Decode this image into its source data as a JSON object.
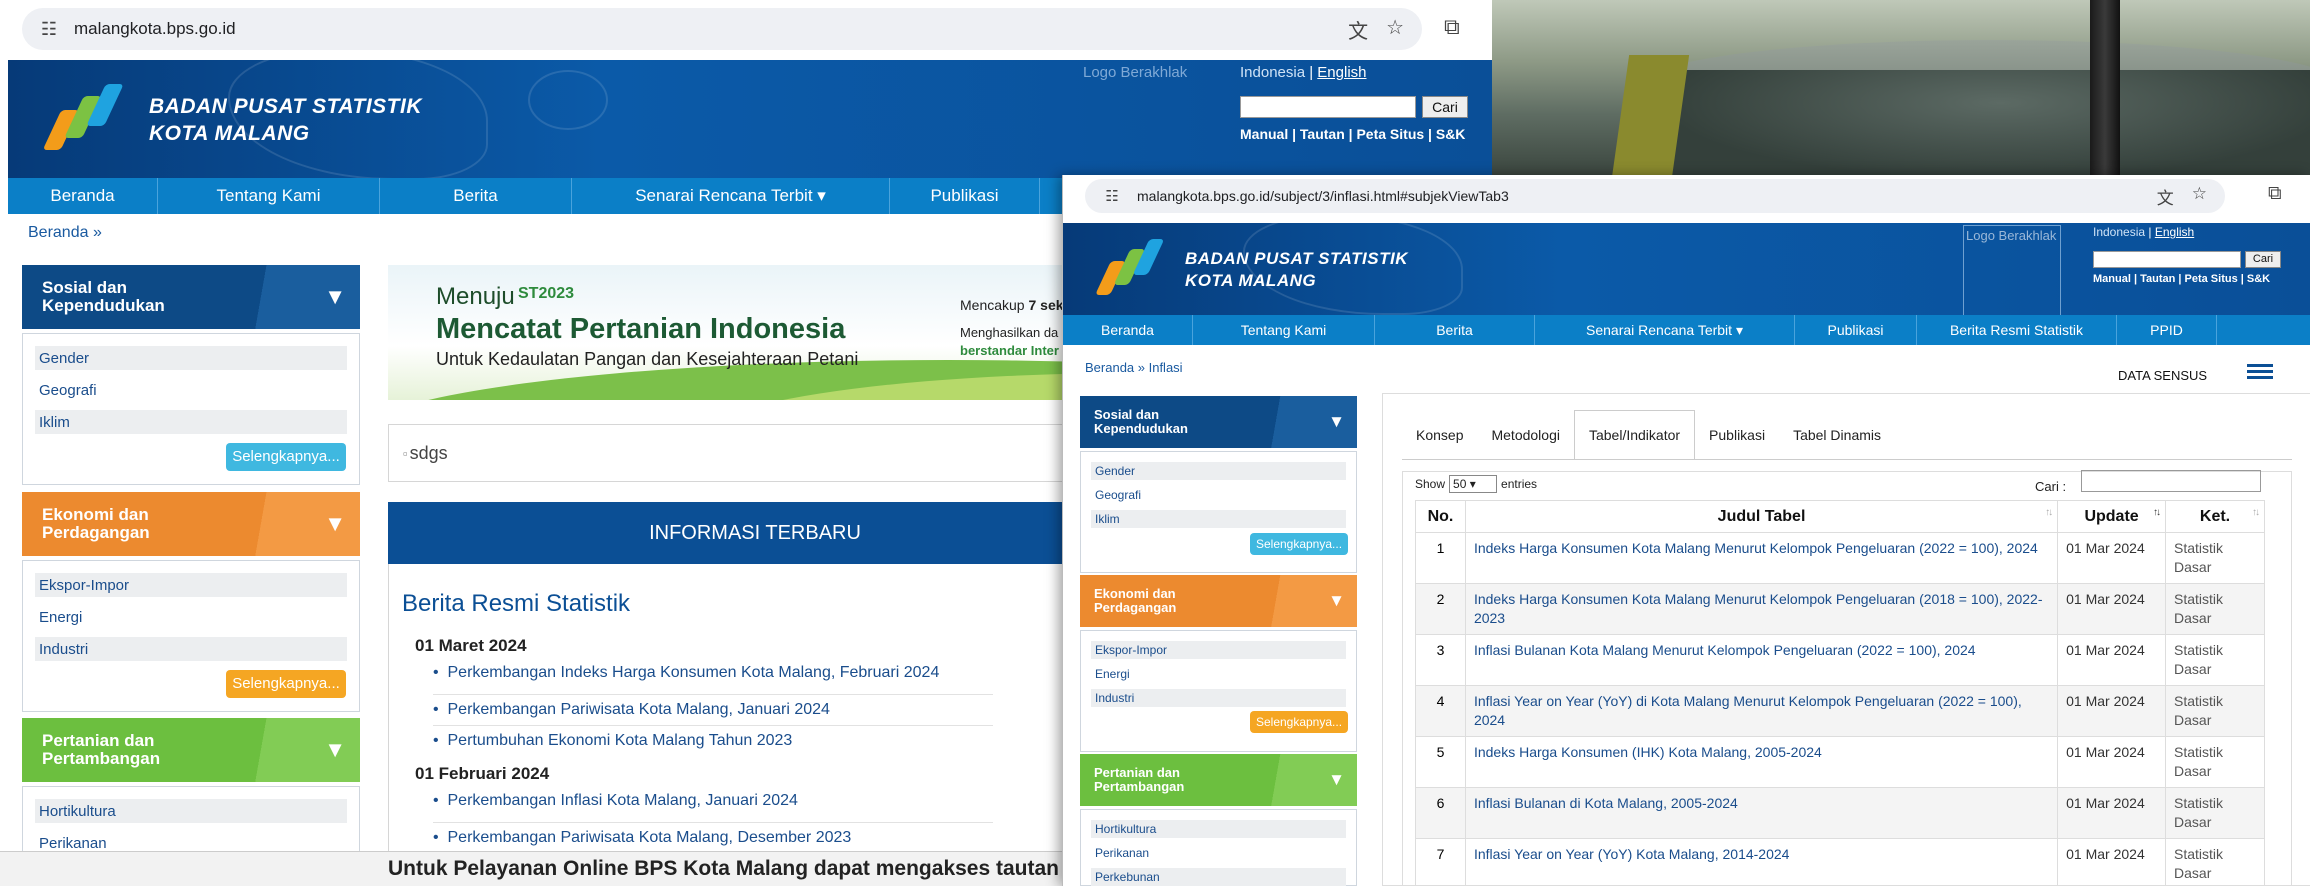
{
  "win1": {
    "url": "malangkota.bps.go.id",
    "brand_line1": "BADAN PUSAT STATISTIK",
    "brand_line2": "KOTA MALANG",
    "logo_alt": "Logo Berakhlak",
    "lang_id": "Indonesia",
    "lang_sep": " | ",
    "lang_en": "English",
    "search_btn": "Cari",
    "links": "Manual | Tautan | Peta Situs | S&K",
    "nav": [
      "Beranda",
      "Tentang Kami",
      "Berita",
      "Senarai Rencana Terbit ▾",
      "Publikasi"
    ],
    "breadcrumb": "Beranda »",
    "sidebar": [
      {
        "title": "Sosial dan Kependudukan",
        "items": [
          "Gender",
          "Geografi",
          "Iklim"
        ],
        "more": "Selengkapnya..."
      },
      {
        "title": "Ekonomi dan Perdagangan",
        "items": [
          "Ekspor-Impor",
          "Energi",
          "Industri"
        ],
        "more": "Selengkapnya..."
      },
      {
        "title": "Pertanian dan Pertambangan",
        "items": [
          "Hortikultura",
          "Perikanan"
        ],
        "more": ""
      }
    ],
    "st_banner": {
      "menuju": "Menuju",
      "st_logo": "ST2023",
      "headline": "Mencatat Pertanian Indonesia",
      "sub": "Untuk Kedaulatan Pangan dan Kesejahteraan Petani",
      "right1": "Mencakup",
      "right1b": "7 sek",
      "right2": "Menghasilkan da",
      "right3": "berstandar Inter"
    },
    "sdgs_alt": "sdgs",
    "info_title": "INFORMASI TERBARU",
    "news_title": "Berita Resmi Statistik",
    "news_groups": [
      {
        "date": "01 Maret 2024",
        "items": [
          "Perkembangan Indeks Harga Konsumen Kota Malang, Februari 2024",
          "Perkembangan Pariwisata Kota Malang, Januari 2024",
          "Pertumbuhan Ekonomi Kota Malang Tahun 2023"
        ]
      },
      {
        "date": "01 Februari 2024",
        "items": [
          "Perkembangan Inflasi Kota Malang, Januari 2024",
          "Perkembangan Pariwisata Kota Malang, Desember 2023"
        ]
      }
    ],
    "bottom_bar": "Untuk Pelayanan Online BPS Kota Malang dapat mengakses tautan"
  },
  "win2": {
    "url": "malangkota.bps.go.id/subject/3/inflasi.html#subjekViewTab3",
    "brand_line1": "BADAN PUSAT STATISTIK",
    "brand_line2": "KOTA MALANG",
    "logo_alt": "Logo Berakhlak",
    "lang_id": "Indonesia",
    "lang_sep": " | ",
    "lang_en": "English",
    "search_btn": "Cari",
    "links": "Manual | Tautan | Peta Situs | S&K",
    "nav": [
      "Beranda",
      "Tentang Kami",
      "Berita",
      "Senarai Rencana Terbit ▾",
      "Publikasi",
      "Berita Resmi Statistik",
      "PPID"
    ],
    "breadcrumb": "Beranda » Inflasi",
    "data_sensus": "DATA SENSUS",
    "sidebar": [
      {
        "title": "Sosial dan Kependudukan",
        "items": [
          "Gender",
          "Geografi",
          "Iklim"
        ],
        "more": "Selengkapnya..."
      },
      {
        "title": "Ekonomi dan Perdagangan",
        "items": [
          "Ekspor-Impor",
          "Energi",
          "Industri"
        ],
        "more": "Selengkapnya..."
      },
      {
        "title": "Pertanian dan Pertambangan",
        "items": [
          "Hortikultura",
          "Perikanan",
          "Perkebunan"
        ],
        "more": ""
      }
    ],
    "tabs": [
      "Konsep",
      "Metodologi",
      "Tabel/Indikator",
      "Publikasi",
      "Tabel Dinamis"
    ],
    "active_tab": 2,
    "show_label": "Show",
    "entries_value": "50",
    "entries_label": "entries",
    "search_label": "Cari :",
    "columns": [
      "No.",
      "Judul Tabel",
      "Update",
      "Ket."
    ],
    "rows": [
      {
        "no": "1",
        "title": "Indeks Harga Konsumen Kota Malang Menurut Kelompok Pengeluaran (2022 = 100), 2024",
        "update": "01 Mar 2024",
        "ket": "Statistik Dasar"
      },
      {
        "no": "2",
        "title": "Indeks Harga Konsumen Kota Malang Menurut Kelompok Pengeluaran (2018 = 100), 2022-2023",
        "update": "01 Mar 2024",
        "ket": "Statistik Dasar"
      },
      {
        "no": "3",
        "title": "Inflasi Bulanan Kota Malang Menurut Kelompok Pengeluaran (2022 = 100), 2024",
        "update": "01 Mar 2024",
        "ket": "Statistik Dasar"
      },
      {
        "no": "4",
        "title": "Inflasi Year on Year (YoY) di Kota Malang Menurut Kelompok Pengeluaran (2022 = 100), 2024",
        "update": "01 Mar 2024",
        "ket": "Statistik Dasar"
      },
      {
        "no": "5",
        "title": "Indeks Harga Konsumen (IHK) Kota Malang, 2005-2024",
        "update": "01 Mar 2024",
        "ket": "Statistik Dasar"
      },
      {
        "no": "6",
        "title": "Inflasi Bulanan di Kota Malang, 2005-2024",
        "update": "01 Mar 2024",
        "ket": "Statistik Dasar"
      },
      {
        "no": "7",
        "title": "Inflasi Year on Year (YoY) Kota Malang, 2014-2024",
        "update": "01 Mar 2024",
        "ket": "Statistik Dasar"
      }
    ]
  },
  "colors": {
    "banner_dark": "#063a78",
    "nav_blue": "#0b7fc7",
    "cat_social": "#0d4a86",
    "cat_econ": "#ec8a2f",
    "cat_agri": "#6cbf3f",
    "more_blue": "#3fb8e0",
    "more_orange": "#f5a623",
    "link_blue": "#1a4d8c"
  },
  "icons": {
    "tune": "tune-icon",
    "translate": "translate-icon",
    "star": "star-icon",
    "extension": "extension-icon",
    "menu": "hamburger-menu-icon"
  }
}
